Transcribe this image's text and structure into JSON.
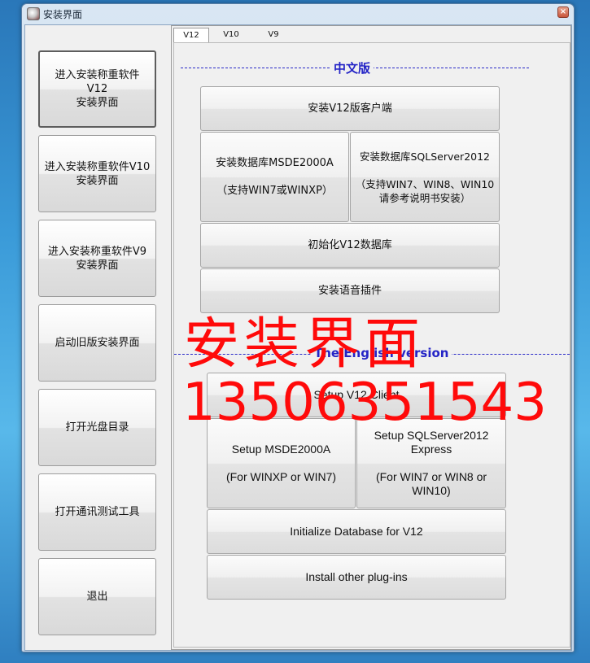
{
  "window": {
    "title": "安装界面",
    "close_glyph": "×"
  },
  "sidebar": {
    "items": [
      {
        "label": "进入安装称重软件 V12\n安装界面"
      },
      {
        "label": "进入安装称重软件V10\n安装界面"
      },
      {
        "label": "进入安装称重软件V9\n安装界面"
      },
      {
        "label": "启动旧版安装界面"
      },
      {
        "label": "打开光盘目录"
      },
      {
        "label": "打开通讯测试工具"
      },
      {
        "label": "退出"
      }
    ]
  },
  "tabs": [
    {
      "label": "V12",
      "active": true
    },
    {
      "label": "V10",
      "active": false
    },
    {
      "label": "V9",
      "active": false
    }
  ],
  "chinese": {
    "section_title": "中文版",
    "install_client": "安装V12版客户端",
    "install_msde": "安装数据库MSDE2000A\n\n（支持WIN7或WINXP）",
    "install_sqlserver": "安装数据库SQLServer2012\n\n（支持WIN7、WIN8、WIN10\n请参考说明书安装）",
    "init_db": "初始化V12数据库",
    "install_voice": "安装语音插件"
  },
  "english": {
    "section_title": "The English version",
    "setup_client": "Setup V12 Client",
    "setup_msde": "Setup MSDE2000A\n\n(For WINXP or WIN7)",
    "setup_sqlserver": "Setup SQLServer2012\nExpress\n\n(For WIN7 or WIN8 or\nWIN10)",
    "init_db": "Initialize Database for V12",
    "install_plugins": "Install other plug-ins"
  },
  "watermark": {
    "line1": "安装界面",
    "line2": "13506351543",
    "color": "#ff0a0a"
  }
}
